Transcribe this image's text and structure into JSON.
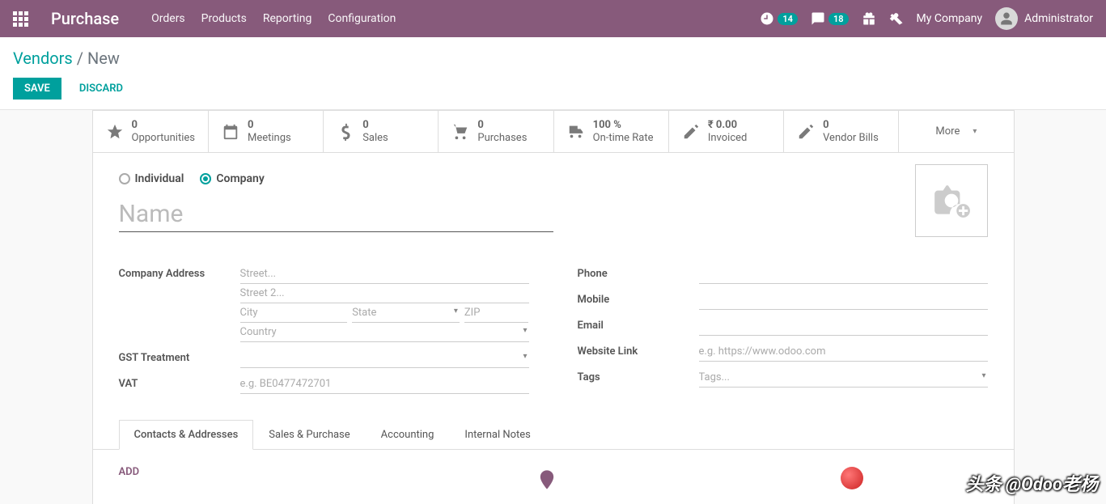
{
  "topbar": {
    "app_name": "Purchase",
    "menu": [
      "Orders",
      "Products",
      "Reporting",
      "Configuration"
    ],
    "activity_count": "14",
    "messages_count": "18",
    "company": "My Company",
    "user": "Administrator"
  },
  "breadcrumb": {
    "parent": "Vendors",
    "sep": "/",
    "current": "New"
  },
  "buttons": {
    "save": "SAVE",
    "discard": "DISCARD"
  },
  "stats": [
    {
      "value": "0",
      "label": "Opportunities",
      "icon": "star"
    },
    {
      "value": "0",
      "label": "Meetings",
      "icon": "calendar"
    },
    {
      "value": "0",
      "label": "Sales",
      "icon": "dollar"
    },
    {
      "value": "0",
      "label": "Purchases",
      "icon": "cart"
    },
    {
      "value": "100  %",
      "label": "On-time Rate",
      "icon": "truck"
    },
    {
      "value": "₹ 0.00",
      "label": "Invoiced",
      "icon": "pencil"
    },
    {
      "value": "0",
      "label": "Vendor Bills",
      "icon": "pencil"
    }
  ],
  "more": "More",
  "type_options": {
    "individual": "Individual",
    "company": "Company",
    "selected": "company"
  },
  "name_placeholder": "Name",
  "left_fields": {
    "address_label": "Company Address",
    "street_ph": "Street...",
    "street2_ph": "Street 2...",
    "city_ph": "City",
    "state_ph": "State",
    "zip_ph": "ZIP",
    "country_ph": "Country",
    "gst_label": "GST Treatment",
    "vat_label": "VAT",
    "vat_ph": "e.g. BE0477472701"
  },
  "right_fields": {
    "phone_label": "Phone",
    "mobile_label": "Mobile",
    "email_label": "Email",
    "website_label": "Website Link",
    "website_ph": "e.g. https://www.odoo.com",
    "tags_label": "Tags",
    "tags_ph": "Tags..."
  },
  "tabs": [
    "Contacts & Addresses",
    "Sales & Purchase",
    "Accounting",
    "Internal Notes"
  ],
  "active_tab": 0,
  "tab_content": {
    "add": "ADD"
  },
  "watermark": "头条 @Odoo老杨"
}
